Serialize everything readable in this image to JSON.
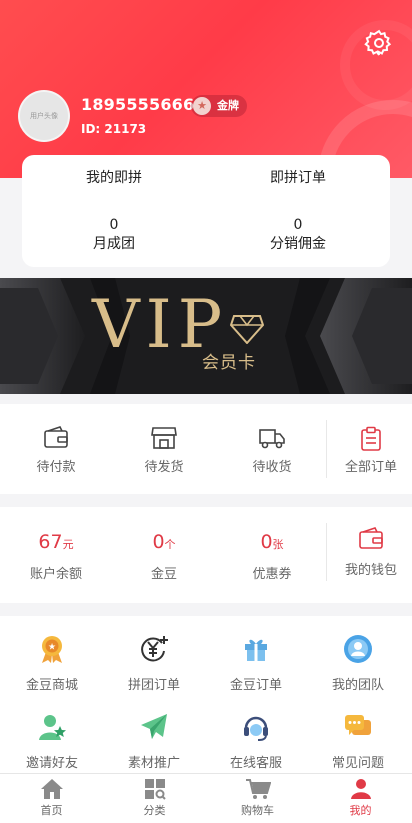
{
  "header": {
    "avatar_alt": "用户头像",
    "phone": "18955556666",
    "level": "金牌",
    "user_id": "ID: 21173"
  },
  "stats": {
    "my_group": "我的即拼",
    "group_orders": "即拼订单",
    "monthly_value": "0",
    "monthly_label": "月成团",
    "commission_value": "0",
    "commission_label": "分销佣金"
  },
  "banner": {
    "title": "VIP",
    "subtitle": "会员卡"
  },
  "orders": {
    "items": [
      {
        "label": "待付款",
        "icon": "wallet-icon"
      },
      {
        "label": "待发货",
        "icon": "shop-icon"
      },
      {
        "label": "待收货",
        "icon": "truck-icon"
      },
      {
        "label": "全部订单",
        "icon": "clipboard-icon"
      }
    ]
  },
  "wallet": {
    "balance_value": "67",
    "balance_unit": "元",
    "balance_label": "账户余额",
    "beans_value": "0",
    "beans_unit": "个",
    "beans_label": "金豆",
    "coupon_value": "0",
    "coupon_unit": "张",
    "coupon_label": "优惠券",
    "my_wallet_label": "我的钱包"
  },
  "services": {
    "items": [
      {
        "label": "金豆商城",
        "icon": "medal-icon"
      },
      {
        "label": "拼团订单",
        "icon": "yen-plus-icon"
      },
      {
        "label": "金豆订单",
        "icon": "gift-icon"
      },
      {
        "label": "我的团队",
        "icon": "team-icon"
      },
      {
        "label": "邀请好友",
        "icon": "invite-user-icon"
      },
      {
        "label": "素材推广",
        "icon": "paper-plane-icon"
      },
      {
        "label": "在线客服",
        "icon": "headset-icon"
      },
      {
        "label": "常见问题",
        "icon": "chat-question-icon"
      }
    ]
  },
  "tabbar": {
    "tabs": [
      {
        "label": "首页",
        "icon": "home-icon"
      },
      {
        "label": "分类",
        "icon": "category-icon"
      },
      {
        "label": "购物车",
        "icon": "cart-icon"
      },
      {
        "label": "我的",
        "icon": "user-icon"
      }
    ],
    "active": "我的"
  },
  "colors": {
    "brand_red": "#ff4d4f",
    "accent_red": "#e03a46",
    "gold": "#c9a56a"
  }
}
